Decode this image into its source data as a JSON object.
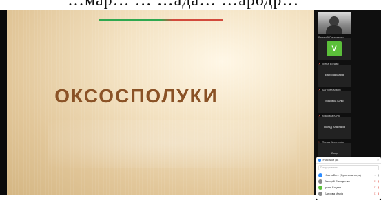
{
  "caption": {
    "text": "…мар… … …ада… …ародр…"
  },
  "slide": {
    "title": "ОКСОСПОЛУКИ"
  },
  "panel": {
    "tiles": [
      {
        "name": "Валерій Самоденко",
        "type": "photo"
      },
      {
        "name": "Ірина Богдан",
        "type": "avatar",
        "initial": "V"
      },
      {
        "name": "Багрова Марія",
        "type": "name"
      },
      {
        "name": "Маковка Юлія",
        "type": "name"
      },
      {
        "name": "Поляд Анастасія",
        "type": "name"
      },
      {
        "name": "Егор",
        "type": "name"
      }
    ]
  },
  "popup": {
    "title": "Учасники (8)",
    "search_placeholder": "Пошук учасника",
    "rows": [
      {
        "name": "Ирина Бо... (Организатор, я)",
        "avatar_color": "#2d8cff"
      },
      {
        "name": "Валерій Самоденко",
        "avatar_color": "#888888"
      },
      {
        "name": "Ірина Богдан",
        "avatar_color": "#5bbf3a"
      },
      {
        "name": "Багрова Марія",
        "avatar_color": "#888888"
      }
    ]
  },
  "colors": {
    "title": "#8a5226",
    "avatar_green": "#5bbf3a",
    "accent_blue": "#2d8cff",
    "mic_red": "#e05a4f"
  }
}
